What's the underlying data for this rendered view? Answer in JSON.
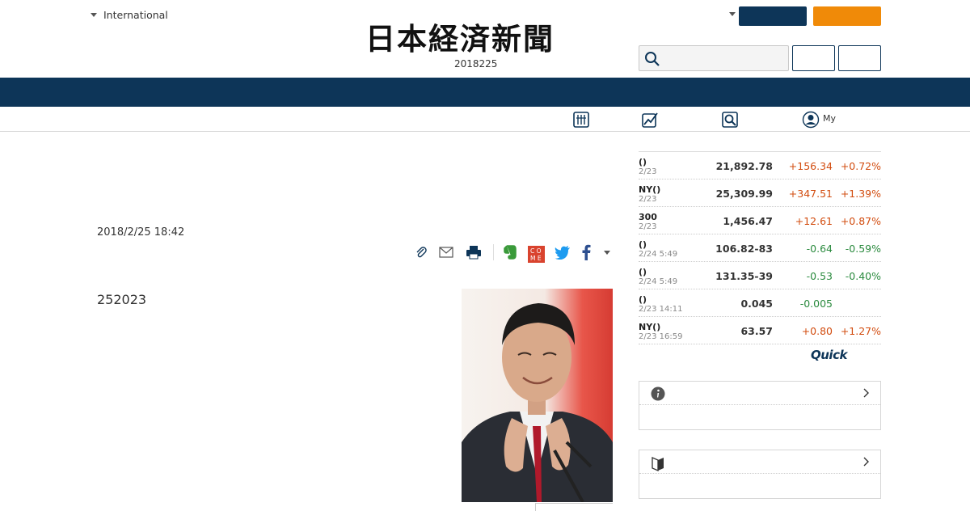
{
  "header": {
    "edition_label": "International",
    "logo_text": "日本経済新聞",
    "date": "2018225"
  },
  "subnav": {
    "my_label": "My"
  },
  "article": {
    "timestamp": "2018/2/25 18:42",
    "lead": "252023"
  },
  "markets": [
    {
      "name": "()",
      "time": "2/23",
      "value": "21,892.78",
      "change": "+156.34",
      "pct": "+0.72%",
      "dir": "up"
    },
    {
      "name": "NY()",
      "time": "2/23",
      "value": "25,309.99",
      "change": "+347.51",
      "pct": "+1.39%",
      "dir": "up"
    },
    {
      "name": "300",
      "time": "2/23",
      "value": "1,456.47",
      "change": "+12.61",
      "pct": "+0.87%",
      "dir": "up"
    },
    {
      "name": "()",
      "time": "2/24 5:49",
      "value": "106.82-83",
      "change": "-0.64",
      "pct": "-0.59%",
      "dir": "down"
    },
    {
      "name": "()",
      "time": "2/24 5:49",
      "value": "131.35-39",
      "change": "-0.53",
      "pct": "-0.40%",
      "dir": "down"
    },
    {
      "name": "()",
      "time": "2/23 14:11",
      "value": "0.045",
      "change": "-0.005",
      "pct": "",
      "dir": "down"
    },
    {
      "name": "NY()",
      "time": "2/23 16:59",
      "value": "63.57",
      "change": "+0.80",
      "pct": "+1.27%",
      "dir": "up"
    }
  ],
  "quick_logo": "Quick",
  "colors": {
    "navy": "#0d3558",
    "orange": "#f08a08",
    "up": "#d24c0f",
    "down": "#2a8a3e"
  },
  "icons": [
    "chevron-down-icon",
    "search-icon",
    "newspaper-icon",
    "chart-icon",
    "magnifier-icon",
    "user-icon",
    "clip-icon",
    "mail-icon",
    "print-icon",
    "evernote-icon",
    "come-icon",
    "twitter-icon",
    "facebook-icon",
    "info-icon",
    "beginner-icon",
    "chevron-right-icon"
  ]
}
